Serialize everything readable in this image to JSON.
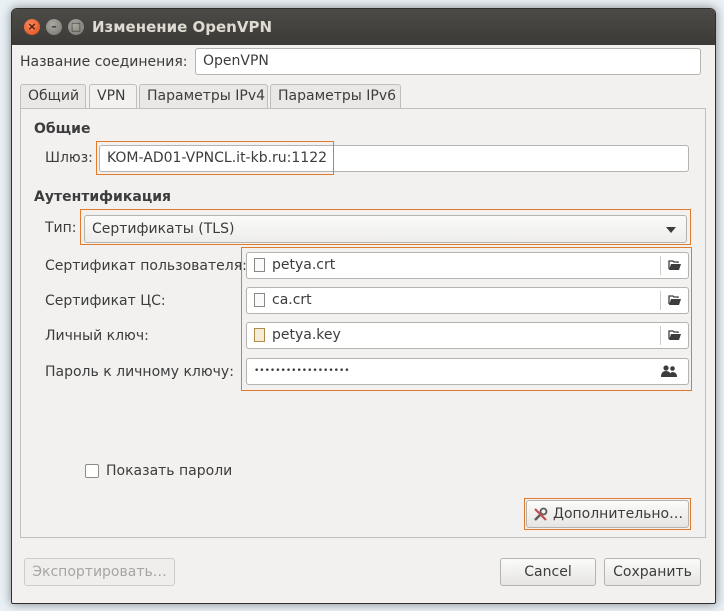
{
  "window": {
    "title": "Изменение OpenVPN"
  },
  "connection": {
    "name_label": "Название соединения:",
    "name_value": "OpenVPN"
  },
  "tabs": [
    {
      "label": "Общий"
    },
    {
      "label": "VPN"
    },
    {
      "label": "Параметры IPv4"
    },
    {
      "label": "Параметры IPv6"
    }
  ],
  "general": {
    "heading": "Общие",
    "gateway_label": "Шлюз:",
    "gateway_value": "KOM-AD01-VPNCL.it-kb.ru:1122"
  },
  "auth": {
    "heading": "Аутентификация",
    "type_label": "Тип:",
    "type_value": "Сертификаты (TLS)",
    "user_cert_label": "Сертификат пользователя:",
    "user_cert_value": "petya.crt",
    "ca_cert_label": "Сертификат ЦС:",
    "ca_cert_value": "ca.crt",
    "private_key_label": "Личный ключ:",
    "private_key_value": "petya.key",
    "key_password_label": "Пароль к личному ключу:",
    "key_password_value": "••••••••••••••••••"
  },
  "show_passwords": {
    "label": "Показать пароли",
    "checked": false
  },
  "buttons": {
    "advanced": "Дополнительно…",
    "export": "Экспортировать…",
    "cancel": "Cancel",
    "save": "Сохранить"
  },
  "colors": {
    "highlight": "#e07a2c",
    "titlebar": "#3b3a36",
    "close_button": "#df4a16"
  }
}
